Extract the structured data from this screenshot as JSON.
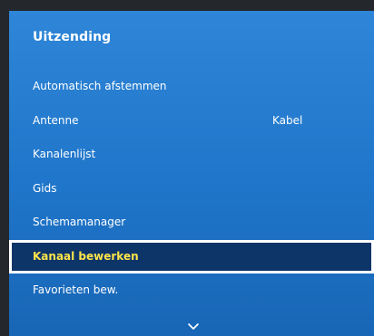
{
  "menu": {
    "title": "Uitzending",
    "items": [
      {
        "label": "Automatisch afstemmen",
        "value": ""
      },
      {
        "label": "Antenne",
        "value": "Kabel"
      },
      {
        "label": "Kanalenlijst",
        "value": ""
      },
      {
        "label": "Gids",
        "value": ""
      },
      {
        "label": "Schemamanager",
        "value": ""
      },
      {
        "label": "Kanaal bewerken",
        "value": "",
        "selected": true
      },
      {
        "label": "Favorieten bew.",
        "value": ""
      }
    ]
  },
  "colors": {
    "panel": "#1f75c9",
    "highlight_background": "#0d3568",
    "highlight_text": "#ffe44a",
    "frame": "#24272c"
  },
  "icons": {
    "scroll_down": "chevron-down-icon"
  }
}
